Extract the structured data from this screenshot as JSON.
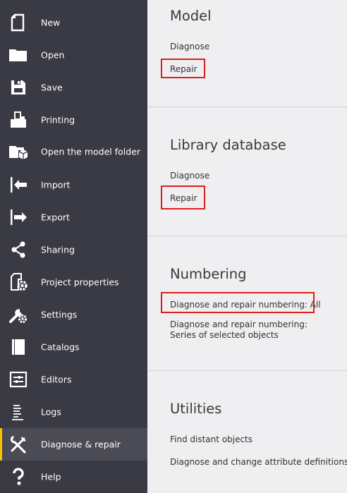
{
  "sidebar": {
    "items": [
      {
        "label": "New",
        "icon": "new-file-icon"
      },
      {
        "label": "Open",
        "icon": "folder-icon"
      },
      {
        "label": "Save",
        "icon": "floppy-disk-icon"
      },
      {
        "label": "Printing",
        "icon": "printer-icon"
      },
      {
        "label": "Open the model folder",
        "icon": "model-folder-icon"
      },
      {
        "label": "Import",
        "icon": "import-icon"
      },
      {
        "label": "Export",
        "icon": "export-icon"
      },
      {
        "label": "Sharing",
        "icon": "share-icon"
      },
      {
        "label": "Project properties",
        "icon": "project-properties-icon"
      },
      {
        "label": "Settings",
        "icon": "settings-icon"
      },
      {
        "label": "Catalogs",
        "icon": "catalog-book-icon"
      },
      {
        "label": "Editors",
        "icon": "editors-icon"
      },
      {
        "label": "Logs",
        "icon": "logs-icon"
      },
      {
        "label": "Diagnose & repair",
        "icon": "diagnose-repair-icon",
        "active": true
      },
      {
        "label": "Help",
        "icon": "help-icon"
      }
    ],
    "accent_color": "#f5c400",
    "background_color": "#393a44"
  },
  "main": {
    "model": {
      "title": "Model",
      "diagnose": "Diagnose",
      "repair": "Repair"
    },
    "library_database": {
      "title": "Library database",
      "diagnose": "Diagnose",
      "repair": "Repair"
    },
    "numbering": {
      "title": "Numbering",
      "repair_all": "Diagnose and repair numbering: All",
      "repair_series": "Diagnose and repair numbering: Series of selected objects"
    },
    "utilities": {
      "title": "Utilities",
      "find_distant": "Find distant objects",
      "change_attributes": "Diagnose and change attribute definitions"
    },
    "highlight_color": "#d9201e"
  }
}
